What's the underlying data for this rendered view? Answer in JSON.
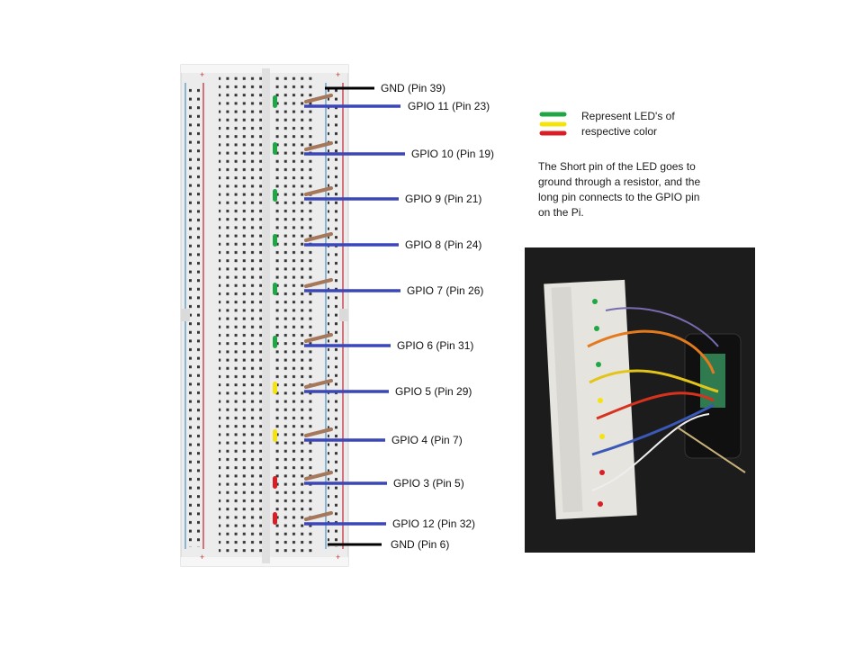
{
  "labels": [
    {
      "id": "gnd-top",
      "text": "GND (Pin 39)"
    },
    {
      "id": "gpio11",
      "text": "GPIO 11 (Pin 23)"
    },
    {
      "id": "gpio10",
      "text": "GPIO 10 (Pin 19)"
    },
    {
      "id": "gpio9",
      "text": "GPIO 9 (Pin 21)"
    },
    {
      "id": "gpio8",
      "text": "GPIO 8 (Pin 24)"
    },
    {
      "id": "gpio7",
      "text": "GPIO 7 (Pin 26)"
    },
    {
      "id": "gpio6",
      "text": "GPIO 6 (Pin 31)"
    },
    {
      "id": "gpio5",
      "text": "GPIO 5 (Pin 29)"
    },
    {
      "id": "gpio4",
      "text": "GPIO 4 (Pin 7)"
    },
    {
      "id": "gpio3",
      "text": "GPIO 3 (Pin 5)"
    },
    {
      "id": "gpio12",
      "text": "GPIO 12 (Pin 32)"
    },
    {
      "id": "gnd-bottom",
      "text": "GND (Pin 6)"
    }
  ],
  "leds": [
    "green",
    "green",
    "green",
    "green",
    "green",
    "green",
    "yellow",
    "yellow",
    "red",
    "red"
  ],
  "colors": {
    "green": "#21a645",
    "yellow": "#f4e30f",
    "red": "#d81f26",
    "wire": "#3b46b8",
    "ground": "#000000",
    "resistor": "#a5785c"
  },
  "legend": {
    "text": "Represent LED's of respective color",
    "colors": [
      "#21a645",
      "#f4e30f",
      "#d81f26"
    ]
  },
  "note": "The Short pin of the LED goes to ground through a resistor, and the long pin connects to the GPIO pin on the Pi."
}
